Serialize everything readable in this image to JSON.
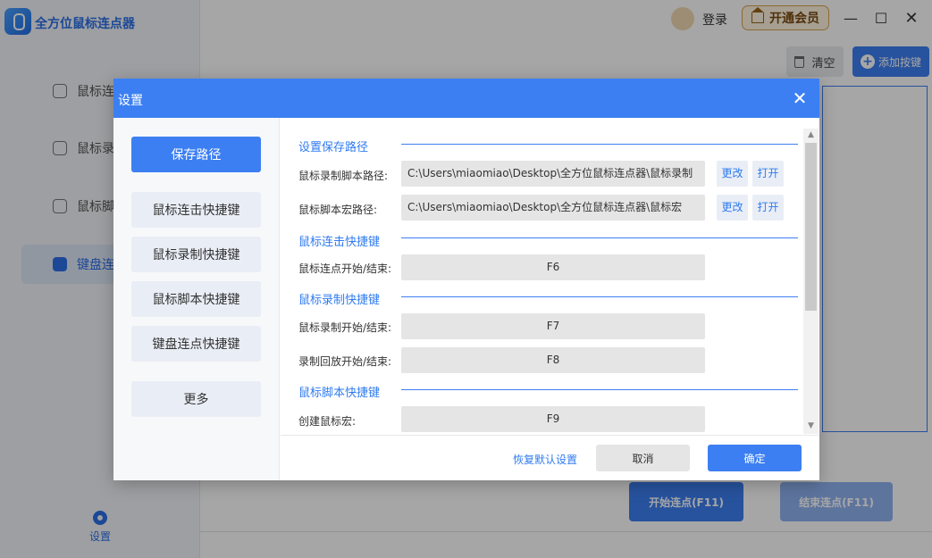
{
  "app": {
    "title": "全方位鼠标连点器",
    "login": "登录",
    "vip": "开通会员",
    "clear": "清空",
    "add_key": "添加按键",
    "start": "开始连点(F11)",
    "stop": "结束连点(F11)",
    "settings": "设置",
    "nav": [
      {
        "label": "鼠标连",
        "icon": "mouse-icon"
      },
      {
        "label": "鼠标录",
        "icon": "video-record-icon"
      },
      {
        "label": "鼠标脚",
        "icon": "code-icon"
      },
      {
        "label": "键盘连",
        "icon": "keyboard-icon"
      }
    ]
  },
  "dialog": {
    "title": "设置",
    "tabs": [
      "保存路径",
      "鼠标连击快捷键",
      "鼠标录制快捷键",
      "鼠标脚本快捷键",
      "键盘连点快捷键",
      "更多"
    ],
    "sections": {
      "save_path": "设置保存路径",
      "click": "鼠标连击快捷键",
      "record": "鼠标录制快捷键",
      "script": "鼠标脚本快捷键"
    },
    "rows": {
      "record_path_label": "鼠标录制脚本路径:",
      "record_path_value": "C:\\Users\\miaomiao\\Desktop\\全方位鼠标连点器\\鼠标录制",
      "macro_path_label": "鼠标脚本宏路径:",
      "macro_path_value": "C:\\Users\\miaomiao\\Desktop\\全方位鼠标连点器\\鼠标宏",
      "click_label": "鼠标连点开始/结束:",
      "click_key": "F6",
      "record_label": "鼠标录制开始/结束:",
      "record_key": "F7",
      "playback_label": "录制回放开始/结束:",
      "playback_key": "F8",
      "create_macro_label": "创建鼠标宏:",
      "create_macro_key": "F9"
    },
    "change_btn": "更改",
    "open_btn": "打开",
    "footer": {
      "restore": "恢复默认设置",
      "cancel": "取消",
      "ok": "确定"
    }
  }
}
